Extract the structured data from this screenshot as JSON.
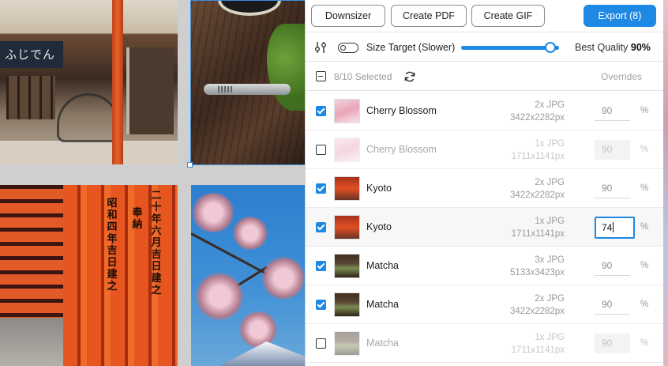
{
  "toolbar": {
    "downsizer_label": "Downsizer",
    "create_pdf_label": "Create PDF",
    "create_gif_label": "Create GIF",
    "export_label": "Export (8)"
  },
  "quality": {
    "size_target_label": "Size Target (Slower)",
    "size_target_enabled": false,
    "best_quality_label": "Best Quality",
    "best_quality_value": "90%",
    "slider_fraction": 0.9
  },
  "list_header": {
    "selected_text": "8/10 Selected",
    "overrides_label": "Overrides"
  },
  "canvas": {
    "shop_sign": "ふじでん",
    "torii_text": [
      "二十年六月吉日建之",
      "奉納",
      "昭和四年吉日建之"
    ]
  },
  "colors": {
    "accent": "#1e88e5"
  },
  "items": [
    {
      "checked": true,
      "name": "Cherry Blossom",
      "thumb": "cherry",
      "scale": "2x JPG",
      "dims": "3422x2282px",
      "quality": "90",
      "unit": "%",
      "dim": false,
      "editing": false
    },
    {
      "checked": false,
      "name": "Cherry Blossom",
      "thumb": "cherry",
      "scale": "1x JPG",
      "dims": "1711x1141px",
      "quality": "90",
      "unit": "%",
      "dim": true,
      "editing": false
    },
    {
      "checked": true,
      "name": "Kyoto",
      "thumb": "kyoto",
      "scale": "2x JPG",
      "dims": "3422x2282px",
      "quality": "90",
      "unit": "%",
      "dim": false,
      "editing": false
    },
    {
      "checked": true,
      "name": "Kyoto",
      "thumb": "kyoto",
      "scale": "1x JPG",
      "dims": "1711x1141px",
      "quality": "74",
      "unit": "%",
      "dim": false,
      "editing": true
    },
    {
      "checked": true,
      "name": "Matcha",
      "thumb": "matcha",
      "scale": "3x JPG",
      "dims": "5133x3423px",
      "quality": "90",
      "unit": "%",
      "dim": false,
      "editing": false
    },
    {
      "checked": true,
      "name": "Matcha",
      "thumb": "matcha",
      "scale": "2x JPG",
      "dims": "3422x2282px",
      "quality": "90",
      "unit": "%",
      "dim": false,
      "editing": false
    },
    {
      "checked": false,
      "name": "Matcha",
      "thumb": "matcha",
      "scale": "1x JPG",
      "dims": "1711x1141px",
      "quality": "90",
      "unit": "%",
      "dim": true,
      "editing": false
    }
  ]
}
